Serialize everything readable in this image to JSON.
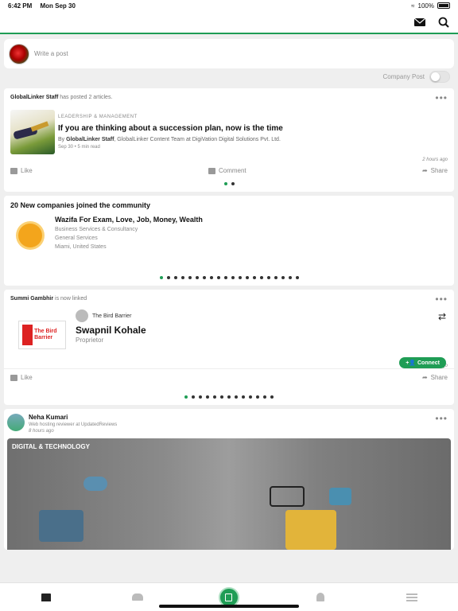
{
  "status_bar": {
    "time": "6:42 PM",
    "date": "Mon Sep 30",
    "battery": "100%"
  },
  "composer": {
    "placeholder": "Write a post",
    "company_post_label": "Company Post"
  },
  "article_card": {
    "poster": "GlobalLinker Staff",
    "action": "has posted 2 articles.",
    "category": "LEADERSHIP & MANAGEMENT",
    "title": "If you are thinking about a succession plan, now is the time",
    "by_prefix": "By",
    "author": "GlobalLinker Staff",
    "author_detail": ", GlobalLinker Content Team at DigiVation Digital Solutions Pvt. Ltd.",
    "meta": "Sep 30  • 5 min read",
    "time": "2 hours ago",
    "like_label": "Like",
    "comment_label": "Comment",
    "share_label": "Share",
    "pages": 2,
    "active_page": 0
  },
  "new_companies": {
    "heading": "20 New companies joined the community",
    "company": {
      "name": "Wazifa For Exam, Love, Job, Money, Wealth",
      "category": "Business Services & Consultancy",
      "subcategory": "General Services",
      "location": "Miami, United States"
    },
    "pages": 20,
    "active_page": 0
  },
  "linked_card": {
    "person": "Summi Gambhir",
    "action": "is now linked",
    "company": "The Bird Barrier",
    "logo_text": "The Bird Barrier",
    "name": "Swapnil Kohale",
    "role": "Proprietor",
    "connect_label": "Connect",
    "time": "4 hours ago",
    "like_label": "Like",
    "share_label": "Share",
    "pages": 13,
    "active_page": 0
  },
  "post_card": {
    "name": "Neha Kumari",
    "description": "Web hosting reviewer at UpdatedReviews",
    "time": "8 hours ago",
    "tag": "DIGITAL & TECHNOLOGY"
  },
  "tabs": [
    "home-icon",
    "people-icon",
    "shop-icon",
    "bell-icon",
    "menu-icon"
  ],
  "colors": {
    "accent": "#1f9d55",
    "background": "#efefef"
  }
}
